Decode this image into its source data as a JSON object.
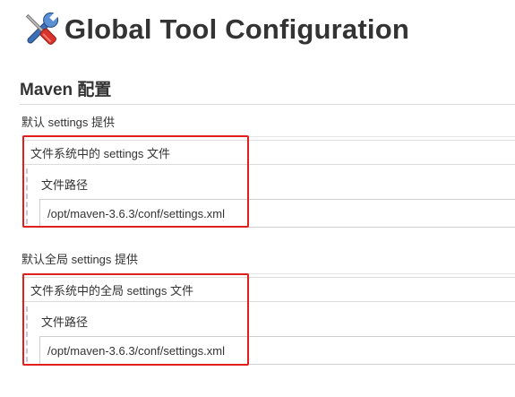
{
  "header": {
    "title": "Global Tool Configuration",
    "icon": "tools-icon"
  },
  "maven": {
    "section_title": "Maven 配置",
    "settings": {
      "label": "默认 settings 提供",
      "selected_option": "文件系统中的 settings 文件",
      "path_label": "文件路径",
      "path_value": "/opt/maven-3.6.3/conf/settings.xml"
    },
    "global_settings": {
      "label": "默认全局 settings 提供",
      "selected_option": "文件系统中的全局 settings 文件",
      "path_label": "文件路径",
      "path_value": "/opt/maven-3.6.3/conf/settings.xml"
    }
  },
  "colors": {
    "highlight": "#e0201f",
    "wrench": "#3d6fb6",
    "screwdriver_handle": "#d9342b"
  }
}
